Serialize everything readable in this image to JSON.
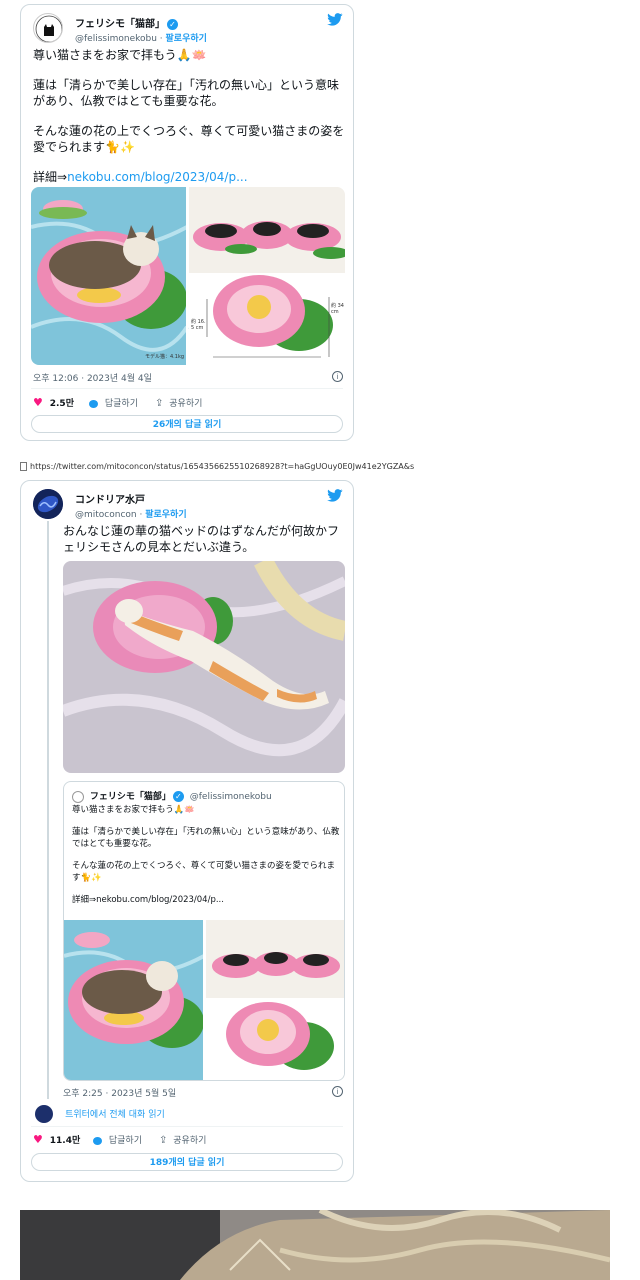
{
  "tweet1": {
    "display_name": "フェリシモ「猫部」",
    "handle": "@felissimonekobu",
    "follow_label": "팔로우하기",
    "paragraphs": [
      "尊い猫さまをお家で拝もう🙏🪷",
      "蓮は「清らかで美しい存在」「汚れの無い心」という意味があり、仏教ではとても重要な花。",
      "そんな蓮の花の上でくつろぐ、尊くて可愛い猫さまの姿を愛でられます🐈✨"
    ],
    "link_prefix": "詳細⇒",
    "link_text": "nekobu.com/blog/2023/04/p...",
    "timestamp": "오후 12:06 · 2023년 4월 4일",
    "like_count": "2.5만",
    "reply_label": "답글하기",
    "share_label": "공유하기",
    "read_replies": "26개의 답글 읽기",
    "image_captions": {
      "height_label": "約 16.5 cm",
      "width_label": "約 34 cm",
      "model_label": "モデル猫：4.1kg"
    }
  },
  "url_line": "https://twitter.com/mitoconcon/status/1654356625510268928?t=haGgUOuy0E0Jw41e2YGZA&s",
  "tweet2": {
    "display_name": "コンドリア水戸",
    "handle": "@mitoconcon",
    "follow_label": "팔로우하기",
    "paragraphs": [
      "おんなじ蓮の華の猫ベッドのはずなんだが何故かフェリシモさんの見本とだいぶ違う。"
    ],
    "quoted": {
      "display_name": "フェリシモ「猫部」",
      "handle": "@felissimonekobu",
      "paragraphs": [
        "尊い猫さまをお家で拝もう🙏🪷",
        "蓮は「清らかで美しい存在」「汚れの無い心」という意味があり、仏教ではとても重要な花。",
        "そんな蓮の花の上でくつろぐ、尊くて可愛い猫さまの姿を愛でられます🐈✨"
      ],
      "link_prefix": "詳細⇒",
      "link_text": "nekobu.com/blog/2023/04/p..."
    },
    "timestamp": "오후 2:25 · 2023년 5월 5일",
    "conversation_label": "트위터에서 전체 대화 읽기",
    "like_count": "11.4만",
    "reply_label": "답글하기",
    "share_label": "공유하기",
    "read_replies": "189개의 답글 읽기"
  },
  "colors": {
    "accent": "#1d9bf0",
    "like": "#f91880",
    "border": "#cfd9de",
    "muted": "#536471"
  }
}
